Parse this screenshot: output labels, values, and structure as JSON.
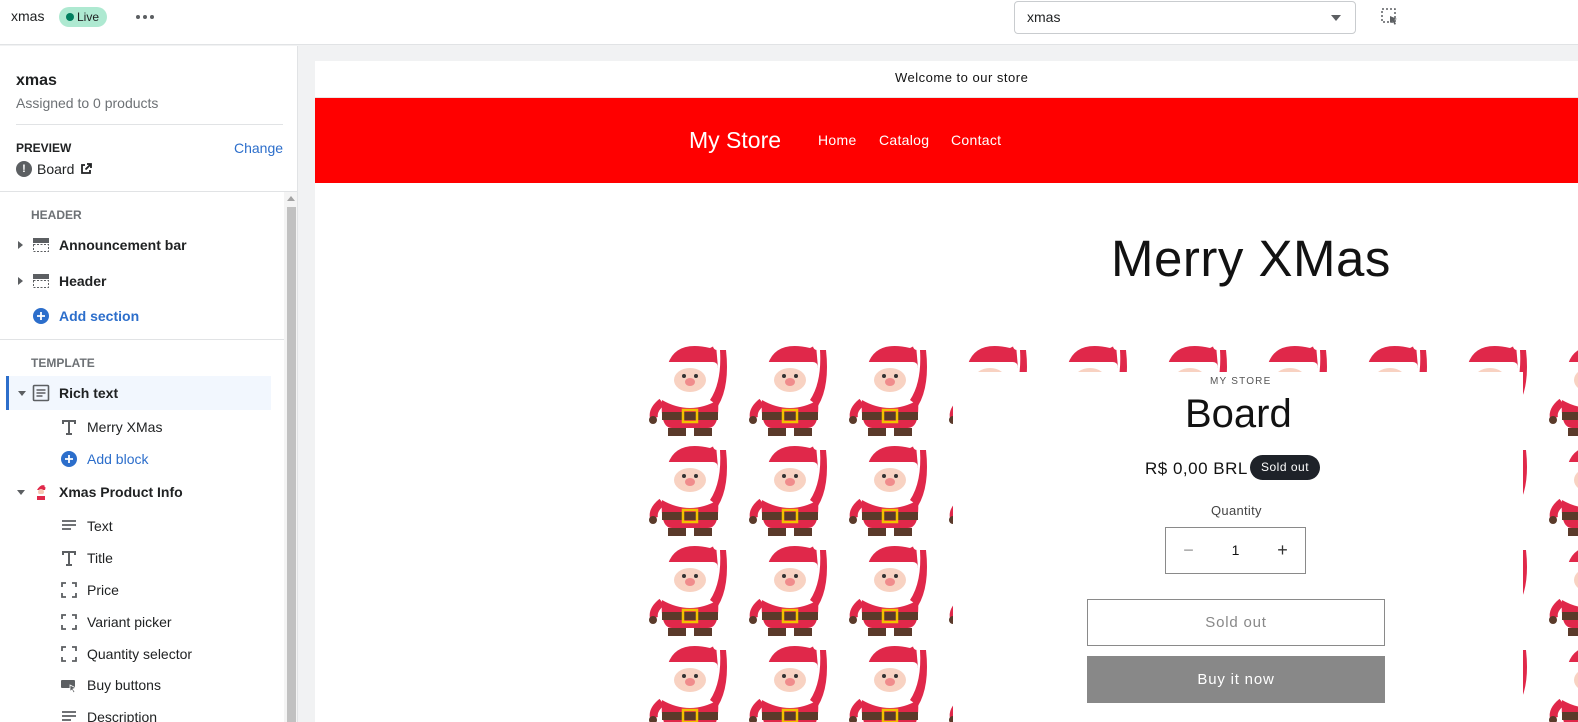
{
  "topbar": {
    "title": "xmas",
    "status": "Live",
    "template_value": "xmas",
    "icons": {
      "more": "more-horizontal-icon",
      "inspector": "select-inspector-icon"
    }
  },
  "sidebar": {
    "title": "xmas",
    "subtitle": "Assigned to 0 products",
    "preview_label": "PREVIEW",
    "change_label": "Change",
    "preview_product": "Board",
    "header_group": "HEADER",
    "header_items": [
      {
        "label": "Announcement bar"
      },
      {
        "label": "Header"
      }
    ],
    "add_section": "Add section",
    "template_group": "TEMPLATE",
    "rich_text": {
      "label": "Rich text",
      "blocks": [
        "Merry XMas"
      ],
      "add_block": "Add block"
    },
    "product_info": {
      "label": "Xmas Product Info",
      "blocks": [
        "Text",
        "Title",
        "Price",
        "Variant picker",
        "Quantity selector",
        "Buy buttons",
        "Description"
      ]
    }
  },
  "store": {
    "announcement": "Welcome to our store",
    "name": "My Store",
    "nav": [
      "Home",
      "Catalog",
      "Contact"
    ],
    "heading": "Merry XMas",
    "header_color": "#ff0000",
    "product": {
      "vendor": "MY STORE",
      "title": "Board",
      "price": "R$ 0,00 BRL",
      "badge": "Sold out",
      "quantity_label": "Quantity",
      "quantity": "1",
      "sold_out_button": "Sold out",
      "buy_now_button": "Buy it now"
    }
  },
  "colors": {
    "accent": "#2c6ecb",
    "live_badge": "#aee9d1",
    "santa_red": "#e0284a"
  }
}
